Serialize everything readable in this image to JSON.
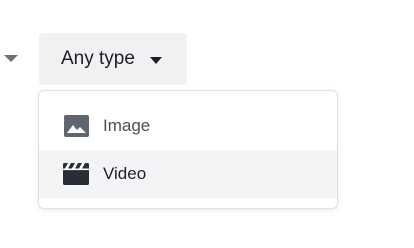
{
  "filter": {
    "label": "Any type",
    "caret_icon": "chevron-down-icon",
    "background_color": "#f0f1f3"
  },
  "menu": {
    "items": [
      {
        "label": "Image",
        "icon": "image-icon",
        "color": "#4b5058"
      },
      {
        "label": "Video",
        "icon": "clapperboard-icon",
        "color": "#1d1f24",
        "hovered": true
      }
    ]
  },
  "colors": {
    "text": "#1d1f24",
    "icon": "#5f6670",
    "hover_bg": "#f3f4f6",
    "border": "#dfe1e5"
  }
}
